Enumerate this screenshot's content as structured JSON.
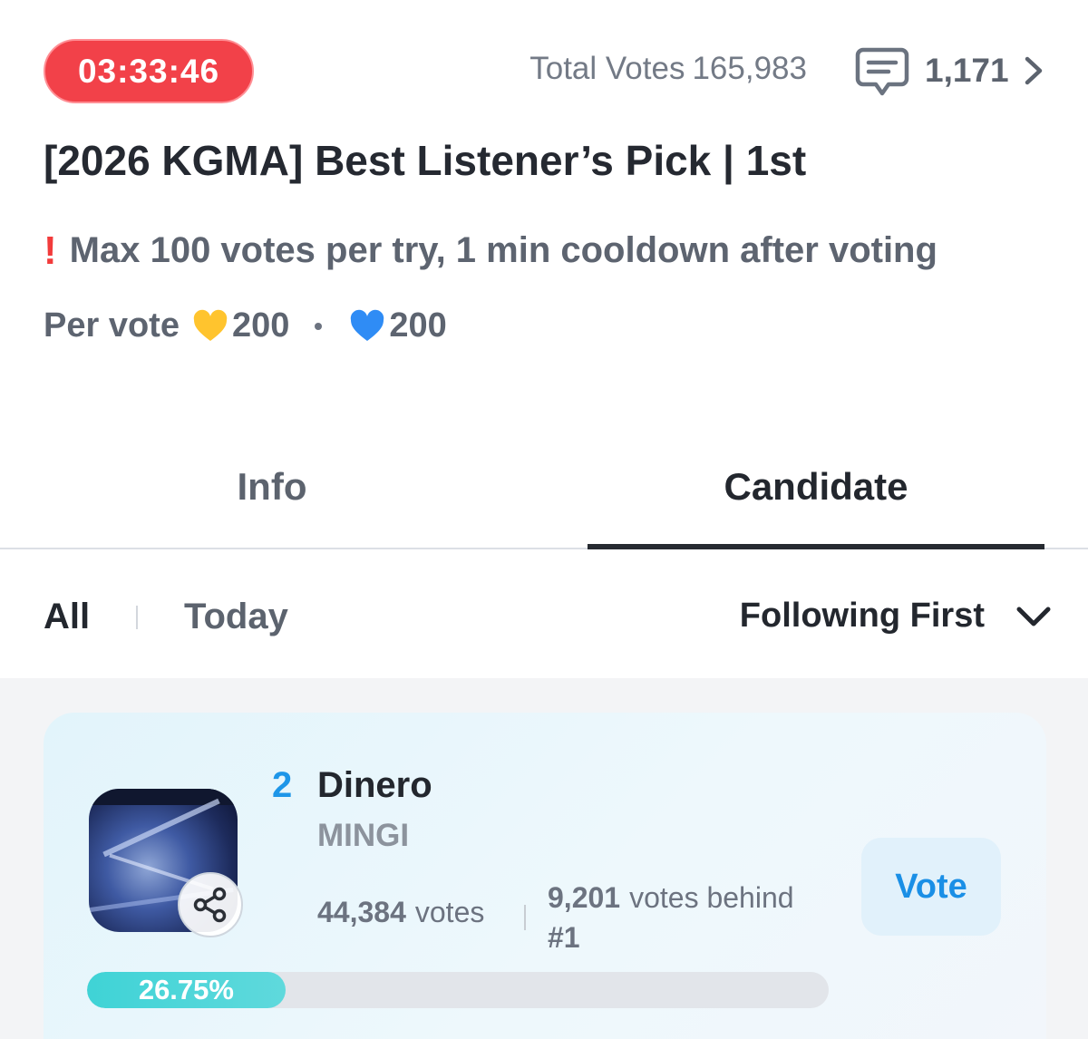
{
  "header": {
    "timer": "03:33:46",
    "total_votes_label": "Total Votes",
    "total_votes_value": "165,983",
    "comment_count": "1,171"
  },
  "title": "[2026 KGMA] Best Listener’s Pick | 1st",
  "notice": {
    "icon": "exclamation-icon",
    "text": "Max 100 votes per try, 1 min cooldown after voting"
  },
  "per_vote": {
    "label": "Per vote",
    "gold_amount": "200",
    "blue_amount": "200",
    "gold_color": "#ffc42e",
    "blue_color": "#2f8cf5"
  },
  "tabs": [
    {
      "label": "Info",
      "active": false
    },
    {
      "label": "Candidate",
      "active": true
    }
  ],
  "filters": {
    "all": "All",
    "today": "Today",
    "sort_label": "Following First"
  },
  "candidates": [
    {
      "rank": "2",
      "song": "Dinero",
      "artist": "MINGI",
      "votes_value": "44,384",
      "votes_unit": "votes",
      "behind_value": "9,201",
      "behind_text": "votes behind",
      "behind_target": "#1",
      "vote_button": "Vote",
      "percent_label": "26.75%",
      "percent": 26.75
    }
  ],
  "colors": {
    "timer_bg": "#f24149",
    "accent_blue": "#1a8fe6",
    "progress": "#3fd3d6"
  }
}
